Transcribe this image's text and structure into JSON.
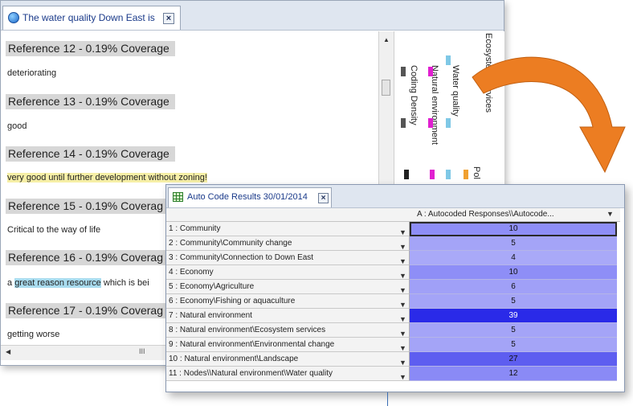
{
  "doc_window": {
    "tab_title": "The water quality Down East is",
    "references": [
      {
        "heading": "Reference 12 - 0.19% Coverage",
        "text": "deteriorating",
        "hl": ""
      },
      {
        "heading": "Reference 13 - 0.19% Coverage",
        "text": "good",
        "hl": ""
      },
      {
        "heading": "Reference 14 - 0.19% Coverage",
        "text": "very good until further development without zoning!",
        "hl": "yellow"
      },
      {
        "heading": "Reference 15 - 0.19% Coverag",
        "text": "Critical to the way of life",
        "hl": ""
      },
      {
        "heading": "Reference 16 - 0.19% Coverag",
        "text_pre": "a ",
        "text_hl": "great reason resource",
        "text_post": " which is bei",
        "hl": "blue"
      },
      {
        "heading": "Reference 17 - 0.19% Coverag",
        "text": "getting worse",
        "hl": ""
      }
    ],
    "stripes": {
      "coding_density": "Coding Density",
      "natural_environment": "Natural environment",
      "water_quality": "Water quality",
      "ecosystem_services": "Ecosystem Services",
      "pol": "Pol"
    },
    "colors": {
      "coding_density": "#333333",
      "natural_environment": "#e020d0",
      "water_quality": "#7fc8e6",
      "ecosystem": "#f0a030",
      "arrow": "#e87a20"
    }
  },
  "results_window": {
    "tab_title": "Auto Code Results 30/01/2014",
    "column_header": "A : Autocoded Responses\\\\Autocode...",
    "rows": [
      {
        "label": "1 : Community",
        "value": "10",
        "color": "#8e8ef7"
      },
      {
        "label": "2 : Community\\Community change",
        "value": "5",
        "color": "#a4a4f7"
      },
      {
        "label": "3 : Community\\Connection to Down East",
        "value": "4",
        "color": "#a9a9f8"
      },
      {
        "label": "4 : Economy",
        "value": "10",
        "color": "#8e8ef7"
      },
      {
        "label": "5 : Economy\\Agriculture",
        "value": "6",
        "color": "#a0a0f7"
      },
      {
        "label": "6 : Economy\\Fishing or aquaculture",
        "value": "5",
        "color": "#a4a4f7"
      },
      {
        "label": "7 : Natural environment",
        "value": "39",
        "color": "#2a2ae8"
      },
      {
        "label": "8 : Natural environment\\Ecosystem services",
        "value": "5",
        "color": "#a4a4f7"
      },
      {
        "label": "9 : Natural environment\\Environmental change",
        "value": "5",
        "color": "#a4a4f7"
      },
      {
        "label": "10 : Natural environment\\Landscape",
        "value": "27",
        "color": "#5e5ef0"
      },
      {
        "label": "11 : Nodes\\\\Natural environment\\Water quality",
        "value": "12",
        "color": "#8a8af6"
      }
    ]
  }
}
